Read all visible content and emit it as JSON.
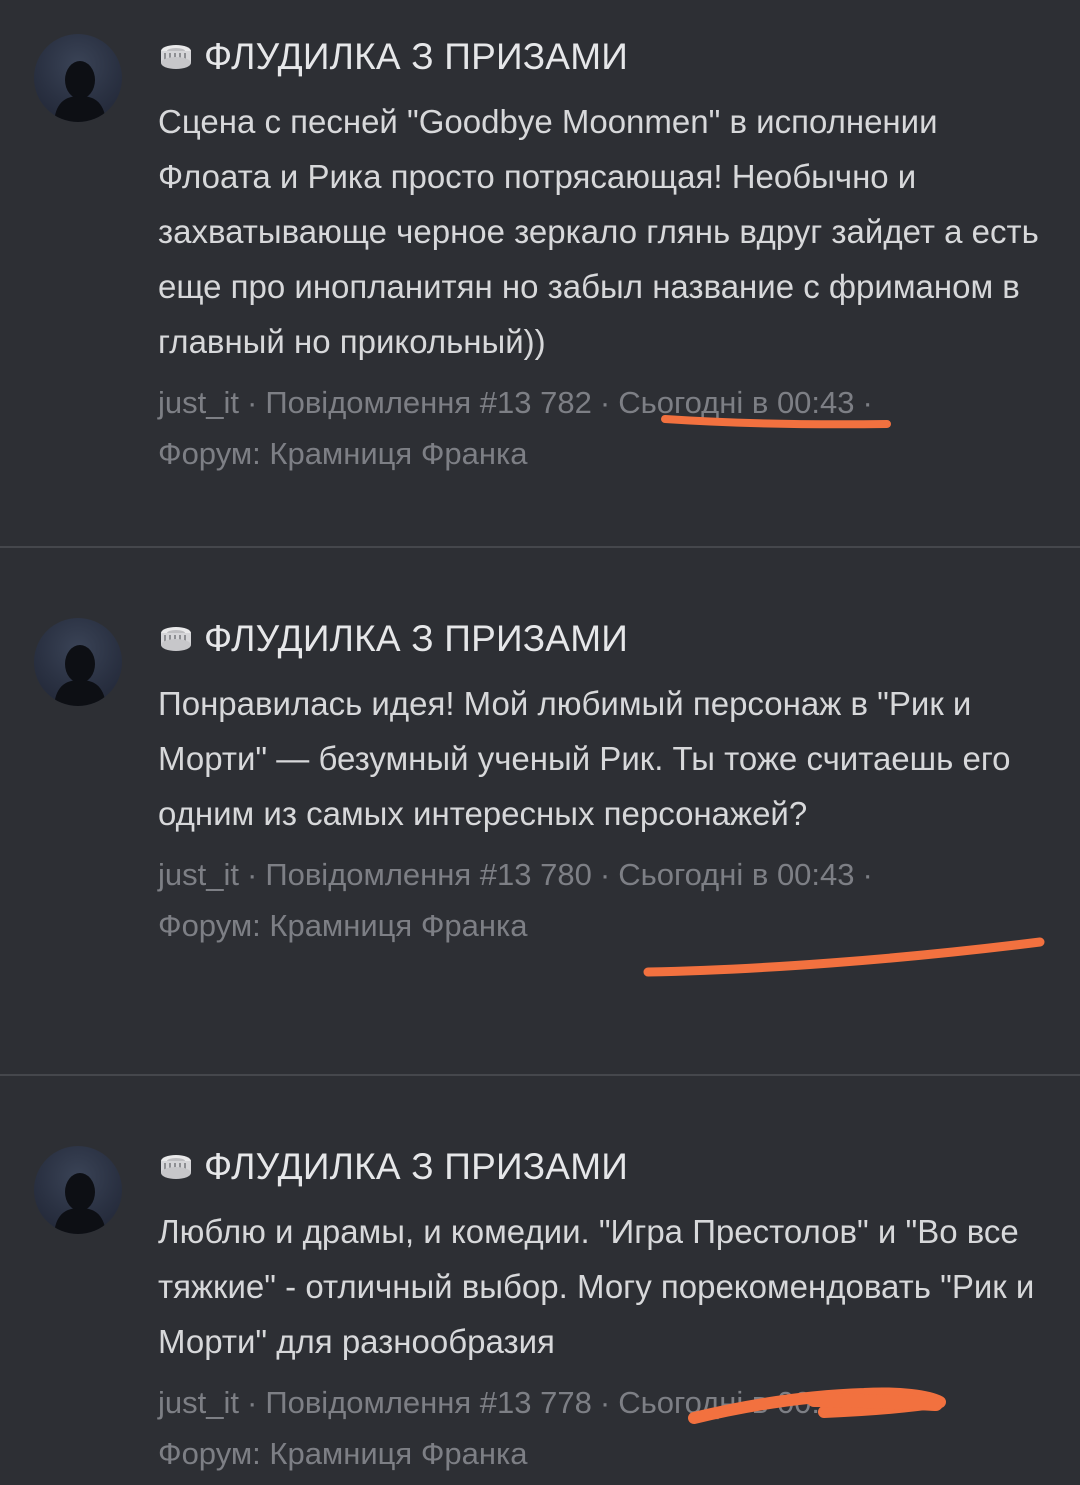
{
  "posts": [
    {
      "topic": "ФЛУДИЛКА З ПРИЗАМИ",
      "message": "Сцена с песней \"Goodbye Moonmen\" в исполнении Флоата и Рика просто потрясающая! Необычно и захватывающе черное зеркало глянь вдруг зайдет а есть еще про иноплaнитян но забыл название с фриманом в главный но прикольный))",
      "author": "just_it",
      "post_number": "Повідомлення #13 782",
      "time": "Сьогодні в 00:43",
      "forum": "Форум: Крамниця Франка"
    },
    {
      "topic": "ФЛУДИЛКА З ПРИЗАМИ",
      "message": "Понравилась идея! Мой любимый персонаж в \"Рик и Морти\" — безумный ученый Рик. Ты тоже считаешь его одним из самых интересных персонажей?",
      "author": "just_it",
      "post_number": "Повідомлення #13 780",
      "time": "Сьогодні в 00:43",
      "forum": "Форум: Крамниця Франка"
    },
    {
      "topic": "ФЛУДИЛКА З ПРИЗАМИ",
      "message": "Люблю и драмы, и комедии. \"Игра Престолов\" и \"Во все тяжкие\" - отличный выбор. Могу порекомендовать \"Рик и Морти\" для разнообразия",
      "author": "just_it",
      "post_number": "Повідомлення #13 778",
      "time": "Сьогодні в 00:43",
      "forum": "Форум: Крамниця Франка"
    }
  ],
  "icons": {
    "topic_icon": "coin-stack-icon",
    "avatar": "user-avatar-silhouette"
  },
  "colors": {
    "background": "#2d2f34",
    "meta_text": "#7d7f85",
    "annotation_stroke": "#f2713f"
  }
}
